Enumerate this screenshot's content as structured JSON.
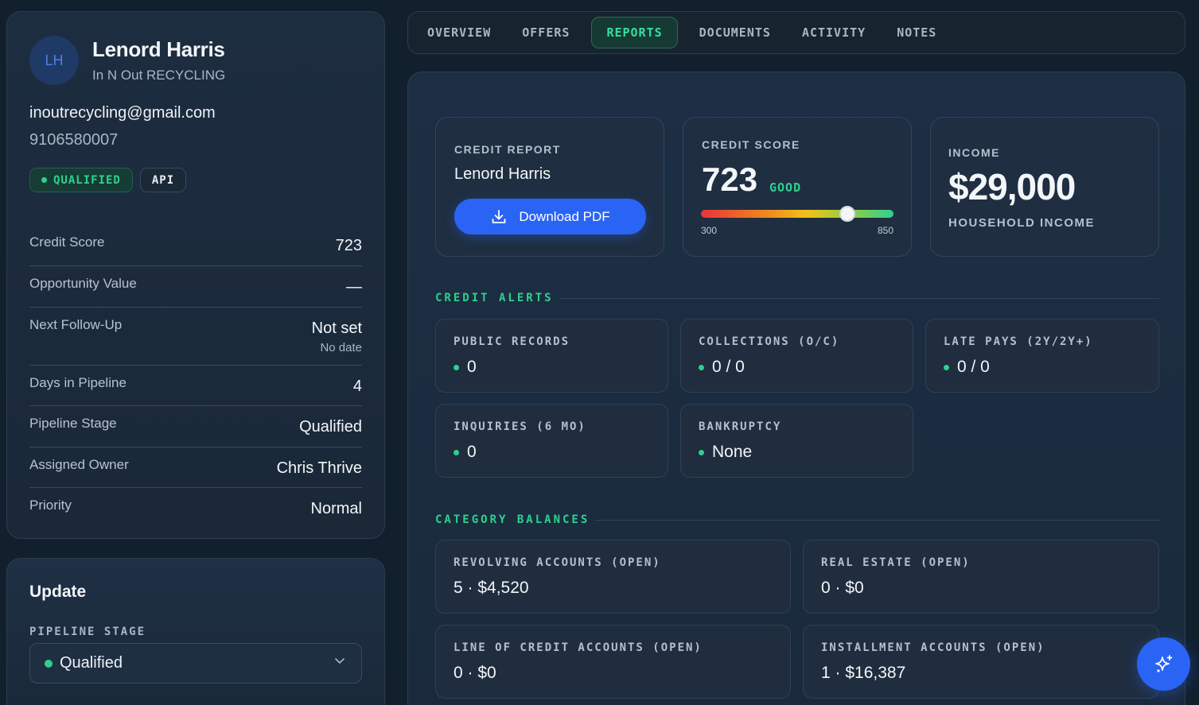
{
  "profile": {
    "initials": "LH",
    "name": "Lenord Harris",
    "company": "In N Out RECYCLING",
    "email": "inoutrecycling@gmail.com",
    "phone": "9106580007",
    "badges": {
      "status": "QUALIFIED",
      "source": "API"
    },
    "details": [
      {
        "label": "Credit Score",
        "value": "723"
      },
      {
        "label": "Opportunity Value",
        "value": "—"
      },
      {
        "label": "Next Follow-Up",
        "value": "Not set",
        "sub": "No date"
      },
      {
        "label": "Days in Pipeline",
        "value": "4"
      },
      {
        "label": "Pipeline Stage",
        "value": "Qualified"
      },
      {
        "label": "Assigned Owner",
        "value": "Chris Thrive"
      },
      {
        "label": "Priority",
        "value": "Normal"
      }
    ]
  },
  "update": {
    "title": "Update",
    "pipeline_label": "PIPELINE STAGE",
    "pipeline_value": "Qualified"
  },
  "tabs": [
    {
      "label": "OVERVIEW",
      "active": false
    },
    {
      "label": "OFFERS",
      "active": false
    },
    {
      "label": "REPORTS",
      "active": true
    },
    {
      "label": "DOCUMENTS",
      "active": false
    },
    {
      "label": "ACTIVITY",
      "active": false
    },
    {
      "label": "NOTES",
      "active": false
    }
  ],
  "credit_report": {
    "label": "CREDIT REPORT",
    "name": "Lenord Harris",
    "download_label": "Download PDF"
  },
  "credit_score": {
    "label": "CREDIT SCORE",
    "value": "723",
    "rating": "GOOD",
    "min": "300",
    "max": "850",
    "score_fraction": 0.76
  },
  "income": {
    "label": "INCOME",
    "value": "$29,000",
    "sub": "HOUSEHOLD INCOME"
  },
  "credit_alerts": {
    "title": "CREDIT ALERTS",
    "items": [
      {
        "label": "PUBLIC RECORDS",
        "value": "0"
      },
      {
        "label": "COLLECTIONS (O/C)",
        "value": "0 / 0"
      },
      {
        "label": "LATE PAYS (2Y/2Y+)",
        "value": "0 / 0"
      },
      {
        "label": "INQUIRIES (6 MO)",
        "value": "0"
      },
      {
        "label": "BANKRUPTCY",
        "value": "None"
      }
    ]
  },
  "category_balances": {
    "title": "CATEGORY BALANCES",
    "items": [
      {
        "label": "REVOLVING ACCOUNTS (OPEN)",
        "value": "5 · $4,520"
      },
      {
        "label": "REAL ESTATE (OPEN)",
        "value": "0 · $0"
      },
      {
        "label": "LINE OF CREDIT ACCOUNTS (OPEN)",
        "value": "0 · $0"
      },
      {
        "label": "INSTALLMENT ACCOUNTS (OPEN)",
        "value": "1 · $16,387"
      }
    ]
  },
  "icons": {
    "download": "download-icon",
    "chevron": "chevron-down-icon",
    "fab": "sparkles-icon"
  },
  "colors": {
    "accent_green": "#2fd08f",
    "primary_blue": "#2a64f5"
  }
}
